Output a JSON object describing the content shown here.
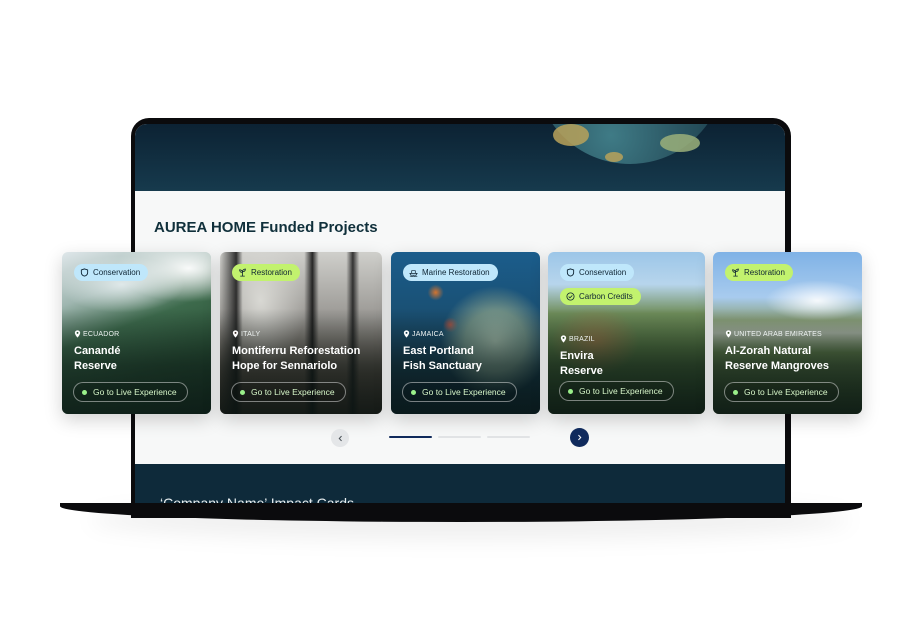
{
  "section": {
    "title": "AUREA HOME Funded Projects"
  },
  "footer_section": {
    "title": "‘Company Name’ Impact Cards"
  },
  "cta_label": "Go to Live Experience",
  "cards": [
    {
      "tags": [
        {
          "label": "Conservation",
          "icon": "shield-icon",
          "color": "blue"
        }
      ],
      "location": "ECUADOR",
      "title": "Canandé\nReserve"
    },
    {
      "tags": [
        {
          "label": "Restoration",
          "icon": "sprout-icon",
          "color": "green"
        }
      ],
      "location": "ITALY",
      "title": "Montiferru Reforestation\nHope for Sennariolo"
    },
    {
      "tags": [
        {
          "label": "Marine Restoration",
          "icon": "boat-icon",
          "color": "blue"
        }
      ],
      "location": "JAMAICA",
      "title": "East Portland\nFish Sanctuary"
    },
    {
      "tags": [
        {
          "label": "Conservation",
          "icon": "shield-icon",
          "color": "blue"
        },
        {
          "label": "Carbon Credits",
          "icon": "check-circle-icon",
          "color": "green"
        }
      ],
      "location": "BRAZIL",
      "title": "Envira\nReserve"
    },
    {
      "tags": [
        {
          "label": "Restoration",
          "icon": "sprout-icon",
          "color": "green"
        }
      ],
      "location": "UNITED ARAB EMIRATES",
      "title": "Al-Zorah Natural\nReserve Mangroves"
    }
  ],
  "pager": {
    "pages": 3,
    "current": 1
  },
  "colors": {
    "tag_blue": "#bfe7fb",
    "tag_green": "#c2f26e",
    "pager_active": "#102a5c",
    "pager_inactive": "#e1e3e5"
  }
}
